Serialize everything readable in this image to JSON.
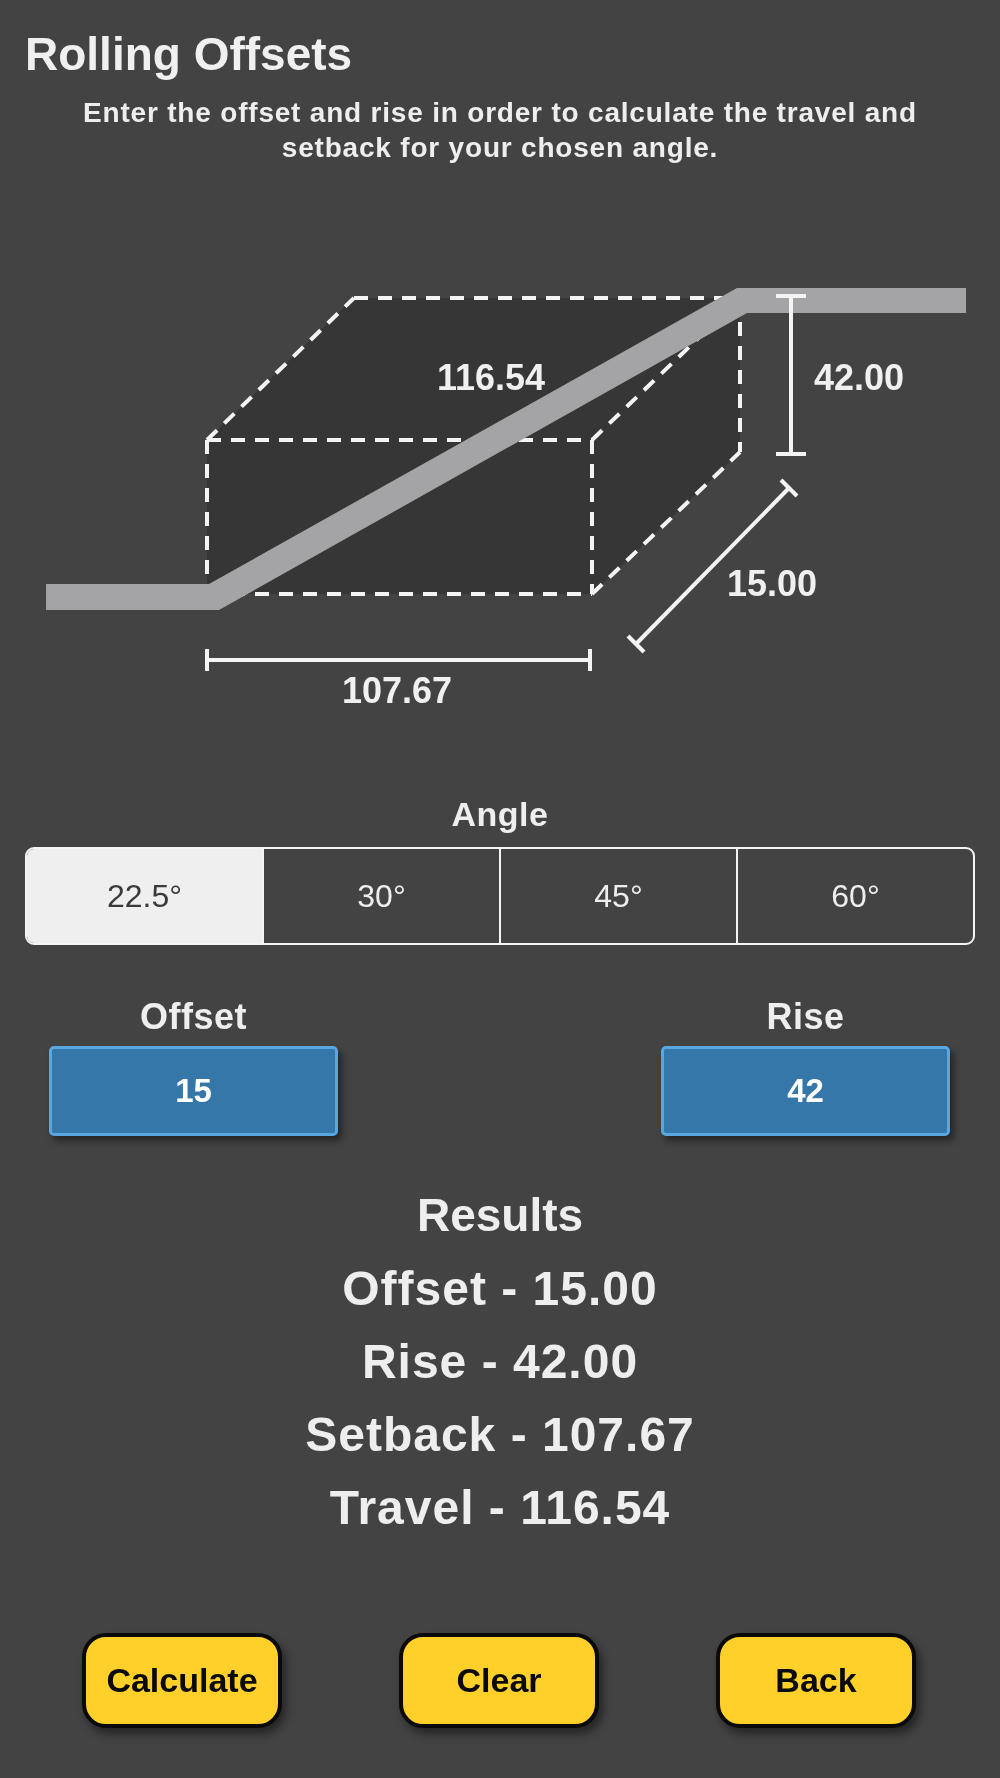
{
  "title": "Rolling Offsets",
  "instructions": "Enter the offset and rise in order to calculate the travel and setback for your chosen angle.",
  "diagram": {
    "travel_label": "116.54",
    "rise_label": "42.00",
    "offset_label": "15.00",
    "setback_label": "107.67"
  },
  "angle": {
    "label": "Angle",
    "options": [
      {
        "label": "22.5°",
        "selected": true
      },
      {
        "label": "30°",
        "selected": false
      },
      {
        "label": "45°",
        "selected": false
      },
      {
        "label": "60°",
        "selected": false
      }
    ]
  },
  "inputs": [
    {
      "label": "Offset",
      "value": "15"
    },
    {
      "label": "Rise",
      "value": "42"
    }
  ],
  "results": {
    "heading": "Results",
    "lines": [
      "Offset - 15.00",
      "Rise - 42.00",
      "Setback - 107.67",
      "Travel - 116.54"
    ]
  },
  "buttons": [
    "Calculate",
    "Clear",
    "Back"
  ]
}
